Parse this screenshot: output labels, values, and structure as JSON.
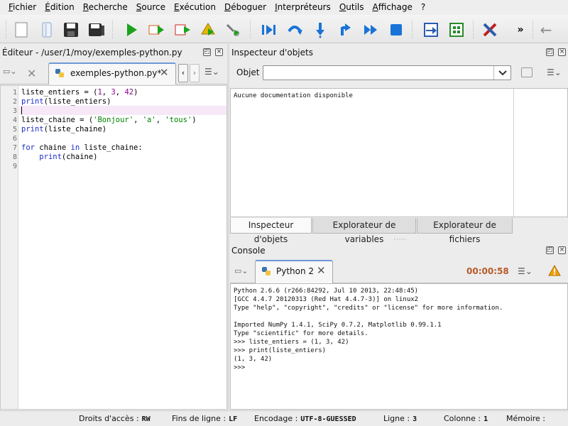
{
  "menubar": [
    "Fichier",
    "Édition",
    "Recherche",
    "Source",
    "Exécution",
    "Déboguer",
    "Interpréteurs",
    "Outils",
    "Affichage",
    "?"
  ],
  "toolbar": {
    "icons": [
      "new-file-icon",
      "open-file-icon",
      "save-icon",
      "save-all-icon",
      "run-icon",
      "run-config-icon",
      "rerun-icon",
      "run-selection-icon",
      "debug-tools-icon",
      "run-cell-icon",
      "pause-icon",
      "step-over-icon",
      "step-into-icon",
      "step-return-icon",
      "continue-icon",
      "stop-icon",
      "maximize-pane-icon",
      "fullscreen-icon",
      "preferences-icon"
    ],
    "overflow": "»",
    "back": "←"
  },
  "editor": {
    "title": "Éditeur - /user/1/moy/exemples-python.py",
    "tab_label": "exemples-python.py*",
    "line_numbers": [
      "1",
      "2",
      "3",
      "4",
      "5",
      "6",
      "7",
      "8",
      "9"
    ],
    "lines": [
      "liste_entiers = (1, 3, 42)",
      "print(liste_entiers)",
      "",
      "liste_chaine = ('Bonjour', 'a', 'tous')",
      "print(liste_chaine)",
      "",
      "for chaine in liste_chaine:",
      "    print(chaine)",
      ""
    ]
  },
  "inspector": {
    "title": "Inspecteur d'objets",
    "object_label": "Objet",
    "object_value": "",
    "doc_text": "Aucune documentation disponible",
    "tabs": [
      "Inspecteur d'objets",
      "Explorateur de variables",
      "Explorateur de fichiers"
    ]
  },
  "console": {
    "title": "Console",
    "tab_label": "Python 2",
    "timer": "00:00:58",
    "lines": [
      "Python 2.6.6 (r266:84292, Jul 10 2013, 22:48:45)",
      "[GCC 4.4.7 20120313 (Red Hat 4.4.7-3)] on linux2",
      "Type \"help\", \"copyright\", \"credits\" or \"license\" for more information.",
      "",
      "Imported NumPy 1.4.1, SciPy 0.7.2, Matplotlib 0.99.1.1",
      "Type \"scientific\" for more details.",
      ">>> liste_entiers = (1, 3, 42)",
      ">>> print(liste_entiers)",
      "(1, 3, 42)",
      ">>>"
    ]
  },
  "status": {
    "access_label": "Droits d'accès :",
    "access_value": "RW",
    "eol_label": "Fins de ligne :",
    "eol_value": "LF",
    "encoding_label": "Encodage :",
    "encoding_value": "UTF-8-GUESSED",
    "line_label": "Ligne :",
    "line_value": "3",
    "column_label": "Colonne :",
    "column_value": "1",
    "memory_label": "Mémoire :"
  }
}
